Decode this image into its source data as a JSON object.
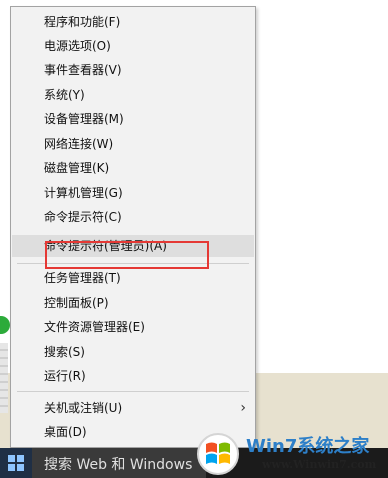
{
  "context_menu": {
    "items": [
      {
        "label": "程序和功能(F)"
      },
      {
        "label": "电源选项(O)"
      },
      {
        "label": "事件查看器(V)"
      },
      {
        "label": "系统(Y)"
      },
      {
        "label": "设备管理器(M)"
      },
      {
        "label": "网络连接(W)"
      },
      {
        "label": "磁盘管理(K)"
      },
      {
        "label": "计算机管理(G)"
      },
      {
        "label": "命令提示符(C)"
      },
      {
        "label": "命令提示符(管理员)(A)",
        "highlighted": true
      },
      {
        "label": "任务管理器(T)"
      },
      {
        "label": "控制面板(P)"
      },
      {
        "label": "文件资源管理器(E)"
      },
      {
        "label": "搜索(S)"
      },
      {
        "label": "运行(R)"
      },
      {
        "label": "关机或注销(U)",
        "submenu": true
      },
      {
        "label": "桌面(D)"
      }
    ],
    "highlight_color": "#dedede",
    "annotation_box_color": "#e53935"
  },
  "taskbar": {
    "search_text": "搜索 Web 和 Windows",
    "start_icon": "windows-logo-icon"
  },
  "watermark": {
    "title": "Win7系统之家",
    "url": "www.Winwin7.com"
  }
}
